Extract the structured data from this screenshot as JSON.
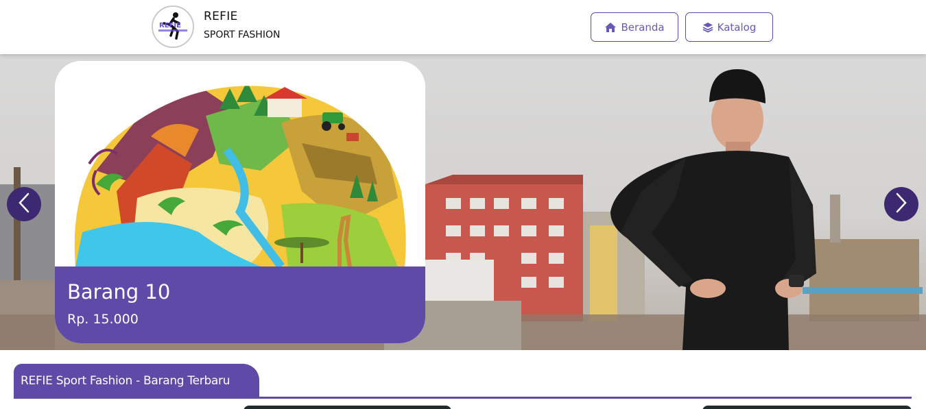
{
  "header": {
    "brand_name": "REFIE",
    "brand_sub": "SPORT FASHION",
    "logo_text": "REFIE"
  },
  "nav": {
    "home_label": "Beranda",
    "catalog_label": "Katalog"
  },
  "carousel": {
    "product_name": "Barang 10",
    "product_price": "Rp. 15.000"
  },
  "section": {
    "title": "REFIE Sport Fashion - Barang Terbaru"
  },
  "colors": {
    "accent": "#5f4aa8",
    "arrow": "#3d2872"
  }
}
